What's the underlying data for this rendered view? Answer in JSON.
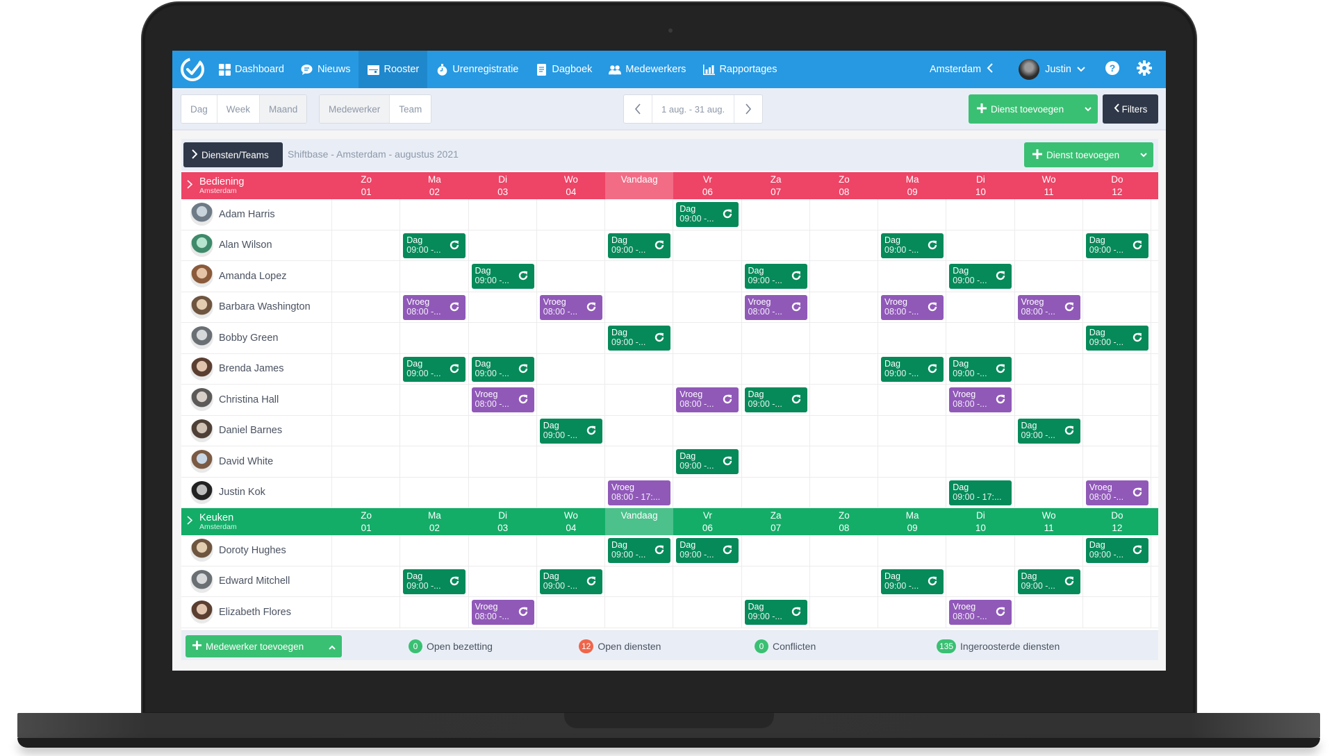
{
  "nav": {
    "items": [
      {
        "label": "Dashboard",
        "icon": "dashboard-icon"
      },
      {
        "label": "Nieuws",
        "icon": "chat-icon"
      },
      {
        "label": "Rooster",
        "icon": "calendar-icon",
        "active": true
      },
      {
        "label": "Urenregistratie",
        "icon": "stopwatch-icon"
      },
      {
        "label": "Dagboek",
        "icon": "notebook-icon"
      },
      {
        "label": "Medewerkers",
        "icon": "users-icon"
      },
      {
        "label": "Rapportages",
        "icon": "bar-chart-icon"
      }
    ],
    "location": "Amsterdam",
    "user": "Justin"
  },
  "toolbar": {
    "view_modes": [
      "Dag",
      "Week",
      "Maand"
    ],
    "active_view": "Maand",
    "group_modes": [
      "Medewerker",
      "Team"
    ],
    "active_group": "Medewerker",
    "date_range": "1 aug. - 31 aug.",
    "add_shift_label": "Dienst toevoegen",
    "filters_label": "Filters"
  },
  "schedule": {
    "teams_button": "Diensten/Teams",
    "title": "Shiftbase - Amsterdam - augustus 2021",
    "add_shift_label": "Dienst toevoegen",
    "days": [
      {
        "dow": "Zo",
        "day": "01"
      },
      {
        "dow": "Ma",
        "day": "02"
      },
      {
        "dow": "Di",
        "day": "03"
      },
      {
        "dow": "Wo",
        "day": "04"
      },
      {
        "dow": "Vandaag",
        "day": "",
        "today": true
      },
      {
        "dow": "Vr",
        "day": "06"
      },
      {
        "dow": "Za",
        "day": "07"
      },
      {
        "dow": "Zo",
        "day": "08"
      },
      {
        "dow": "Ma",
        "day": "09"
      },
      {
        "dow": "Di",
        "day": "10"
      },
      {
        "dow": "Wo",
        "day": "11"
      },
      {
        "dow": "Do",
        "day": "12"
      }
    ],
    "teams": [
      {
        "name": "Bediening",
        "location": "Amsterdam",
        "color": "#ee4466",
        "employees": [
          {
            "name": "Adam Harris",
            "shifts": [
              {
                "d": 5,
                "type": "Dag",
                "time": "09:00 -...",
                "repeat": true
              }
            ]
          },
          {
            "name": "Alan Wilson",
            "shifts": [
              {
                "d": 1,
                "type": "Dag",
                "time": "09:00 -...",
                "repeat": true
              },
              {
                "d": 4,
                "type": "Dag",
                "time": "09:00 -...",
                "repeat": true
              },
              {
                "d": 8,
                "type": "Dag",
                "time": "09:00 -...",
                "repeat": true
              },
              {
                "d": 11,
                "type": "Dag",
                "time": "09:00 -...",
                "repeat": true
              }
            ]
          },
          {
            "name": "Amanda Lopez",
            "shifts": [
              {
                "d": 2,
                "type": "Dag",
                "time": "09:00 -...",
                "repeat": true
              },
              {
                "d": 6,
                "type": "Dag",
                "time": "09:00 -...",
                "repeat": true
              },
              {
                "d": 9,
                "type": "Dag",
                "time": "09:00 -...",
                "repeat": true
              }
            ]
          },
          {
            "name": "Barbara Washington",
            "shifts": [
              {
                "d": 1,
                "type": "Vroeg",
                "time": "08:00 -...",
                "repeat": true
              },
              {
                "d": 3,
                "type": "Vroeg",
                "time": "08:00 -...",
                "repeat": true
              },
              {
                "d": 6,
                "type": "Vroeg",
                "time": "08:00 -...",
                "repeat": true
              },
              {
                "d": 8,
                "type": "Vroeg",
                "time": "08:00 -...",
                "repeat": true
              },
              {
                "d": 10,
                "type": "Vroeg",
                "time": "08:00 -...",
                "repeat": true
              }
            ]
          },
          {
            "name": "Bobby Green",
            "shifts": [
              {
                "d": 4,
                "type": "Dag",
                "time": "09:00 -...",
                "repeat": true
              },
              {
                "d": 11,
                "type": "Dag",
                "time": "09:00 -...",
                "repeat": true
              }
            ]
          },
          {
            "name": "Brenda James",
            "shifts": [
              {
                "d": 1,
                "type": "Dag",
                "time": "09:00 -...",
                "repeat": true
              },
              {
                "d": 2,
                "type": "Dag",
                "time": "09:00 -...",
                "repeat": true
              },
              {
                "d": 8,
                "type": "Dag",
                "time": "09:00 -...",
                "repeat": true
              },
              {
                "d": 9,
                "type": "Dag",
                "time": "09:00 -...",
                "repeat": true
              }
            ]
          },
          {
            "name": "Christina Hall",
            "shifts": [
              {
                "d": 2,
                "type": "Vroeg",
                "time": "08:00 -...",
                "repeat": true
              },
              {
                "d": 5,
                "type": "Vroeg",
                "time": "08:00 -...",
                "repeat": true
              },
              {
                "d": 6,
                "type": "Dag",
                "time": "09:00 -...",
                "repeat": true
              },
              {
                "d": 9,
                "type": "Vroeg",
                "time": "08:00 -...",
                "repeat": true
              }
            ]
          },
          {
            "name": "Daniel Barnes",
            "shifts": [
              {
                "d": 3,
                "type": "Dag",
                "time": "09:00 -...",
                "repeat": true
              },
              {
                "d": 10,
                "type": "Dag",
                "time": "09:00 -...",
                "repeat": true
              }
            ]
          },
          {
            "name": "David White",
            "shifts": [
              {
                "d": 5,
                "type": "Dag",
                "time": "09:00 -...",
                "repeat": true
              }
            ]
          },
          {
            "name": "Justin Kok",
            "shifts": [
              {
                "d": 4,
                "type": "Vroeg",
                "time": "08:00 - 17:...",
                "repeat": false
              },
              {
                "d": 9,
                "type": "Dag",
                "time": "09:00 - 17:...",
                "repeat": false
              },
              {
                "d": 11,
                "type": "Vroeg",
                "time": "08:00 -...",
                "repeat": true
              }
            ]
          }
        ]
      },
      {
        "name": "Keuken",
        "location": "Amsterdam",
        "color": "#13ad68",
        "employees": [
          {
            "name": "Doroty Hughes",
            "shifts": [
              {
                "d": 4,
                "type": "Dag",
                "time": "09:00 -...",
                "repeat": true
              },
              {
                "d": 5,
                "type": "Dag",
                "time": "09:00 -...",
                "repeat": true
              },
              {
                "d": 11,
                "type": "Dag",
                "time": "09:00 -...",
                "repeat": true
              }
            ]
          },
          {
            "name": "Edward Mitchell",
            "shifts": [
              {
                "d": 1,
                "type": "Dag",
                "time": "09:00 -...",
                "repeat": true
              },
              {
                "d": 3,
                "type": "Dag",
                "time": "09:00 -...",
                "repeat": true
              },
              {
                "d": 8,
                "type": "Dag",
                "time": "09:00 -...",
                "repeat": true
              },
              {
                "d": 10,
                "type": "Dag",
                "time": "09:00 -...",
                "repeat": true
              }
            ]
          },
          {
            "name": "Elizabeth Flores",
            "shifts": [
              {
                "d": 2,
                "type": "Vroeg",
                "time": "08:00 -...",
                "repeat": true
              },
              {
                "d": 6,
                "type": "Dag",
                "time": "09:00 -...",
                "repeat": true
              },
              {
                "d": 9,
                "type": "Vroeg",
                "time": "08:00 -...",
                "repeat": true
              }
            ]
          }
        ]
      }
    ]
  },
  "footer": {
    "add_employee_label": "Medewerker toevoegen",
    "stats": [
      {
        "count": "0",
        "label": "Open bezetting",
        "color": "green"
      },
      {
        "count": "12",
        "label": "Open diensten",
        "color": "red"
      },
      {
        "count": "0",
        "label": "Conflicten",
        "color": "green"
      },
      {
        "count": "135",
        "label": "Ingeroosterde diensten",
        "color": "green"
      }
    ]
  }
}
